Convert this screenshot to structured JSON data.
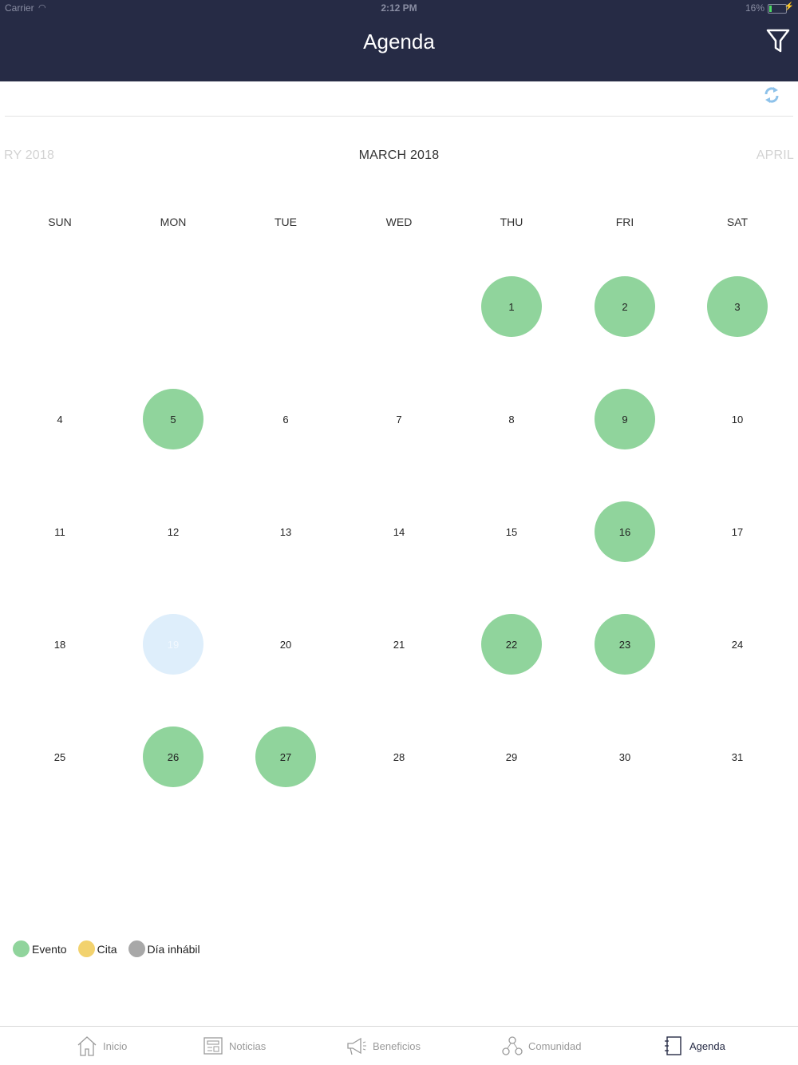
{
  "status_bar": {
    "carrier": "Carrier",
    "time": "2:12 PM",
    "battery": "16%"
  },
  "nav": {
    "title": "Agenda"
  },
  "calendar": {
    "prev_month": "RY 2018",
    "current_month": "MARCH 2018",
    "next_month": "APRIL",
    "weekdays": [
      "SUN",
      "MON",
      "TUE",
      "WED",
      "THU",
      "FRI",
      "SAT"
    ],
    "first_weekday_index": 4,
    "days_in_month": 31,
    "event_days": [
      1,
      2,
      3,
      5,
      9,
      16,
      22,
      23,
      26,
      27
    ],
    "today": 19
  },
  "legend": [
    {
      "label": "Evento",
      "color": "#90d49c"
    },
    {
      "label": "Cita",
      "color": "#f2d26e"
    },
    {
      "label": "Día inhábil",
      "color": "#a8a8a8"
    }
  ],
  "tabs": [
    {
      "label": "Inicio",
      "icon": "home-icon",
      "active": false
    },
    {
      "label": "Noticias",
      "icon": "newspaper-icon",
      "active": false
    },
    {
      "label": "Beneficios",
      "icon": "megaphone-icon",
      "active": false
    },
    {
      "label": "Comunidad",
      "icon": "community-icon",
      "active": false
    },
    {
      "label": "Agenda",
      "icon": "agenda-icon",
      "active": true
    }
  ],
  "colors": {
    "header": "#262b45",
    "evento": "#90d49c",
    "today": "#deeefb",
    "refresh": "#8ec2ea"
  }
}
